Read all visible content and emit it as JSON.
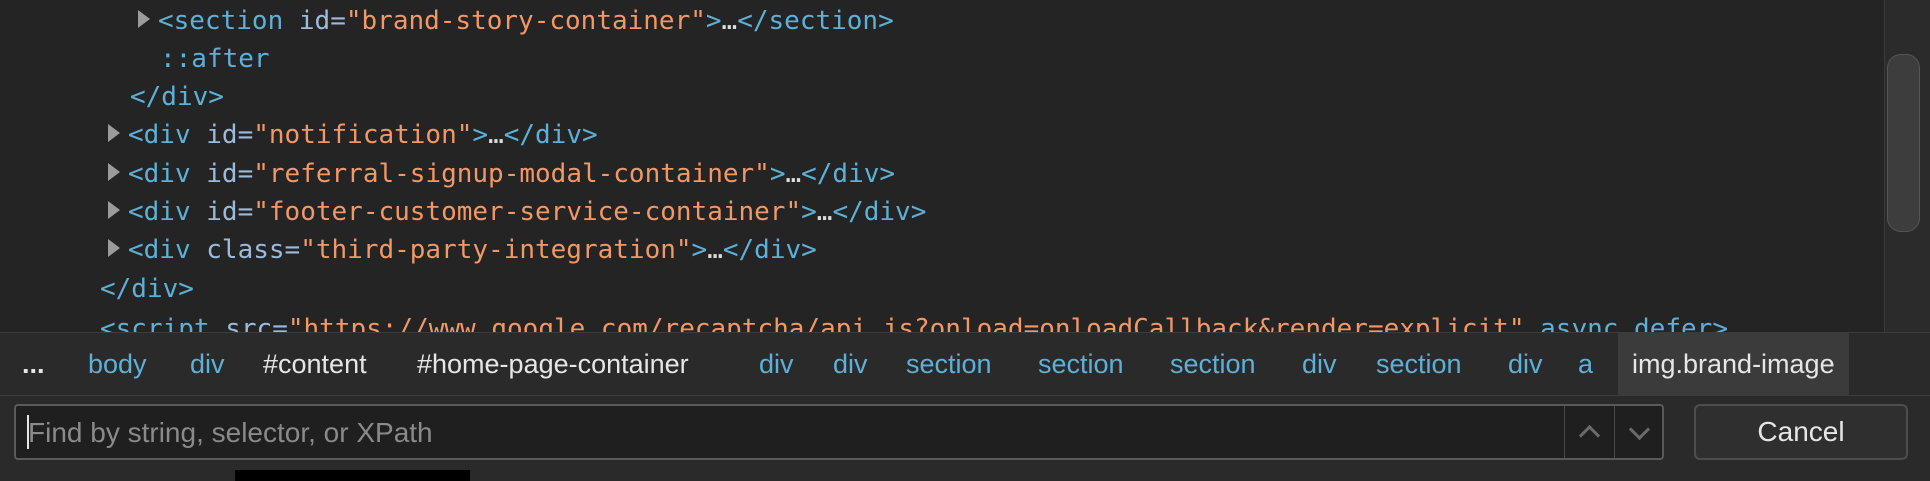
{
  "dom_tree": {
    "lines": [
      {
        "open": "<section",
        "attr": " id=",
        "val": "\"brand-story-container\"",
        "gt": ">",
        "ell": "…",
        "close": "</section>"
      },
      {
        "text": "::after"
      },
      {
        "text": "</div>"
      },
      {
        "open": "<div",
        "attr": " id=",
        "val": "\"notification\"",
        "gt": ">",
        "ell": "…",
        "close": "</div>"
      },
      {
        "open": "<div",
        "attr": " id=",
        "val": "\"referral-signup-modal-container\"",
        "gt": ">",
        "ell": "…",
        "close": "</div>"
      },
      {
        "open": "<div",
        "attr": " id=",
        "val": "\"footer-customer-service-container\"",
        "gt": ">",
        "ell": "…",
        "close": "</div>"
      },
      {
        "open": "<div",
        "attr": " class=",
        "val": "\"third-party-integration\"",
        "gt": ">",
        "ell": "…",
        "close": "</div>"
      },
      {
        "text": "</div>"
      },
      {
        "open": "<script",
        "attr": " src=",
        "val": "\"https://www.google.com/recaptcha/api.js?onload=onloadCallback&render=explicit\"",
        "tail": " async defer>"
      }
    ]
  },
  "breadcrumb": {
    "items": [
      "...",
      "body",
      "div",
      "#content",
      "#home-page-container",
      "div",
      "div",
      "section",
      "section",
      "section",
      "div",
      "section",
      "div",
      "a",
      "img.brand-image"
    ]
  },
  "find_bar": {
    "placeholder": "Find by string, selector, or XPath",
    "value": "",
    "cancel_label": "Cancel"
  },
  "icons": {
    "expand": "disclosure-triangle-icon",
    "prev": "chevron-up-icon",
    "next": "chevron-down-icon"
  },
  "colors": {
    "background": "#242424",
    "tag": "#5db0d7",
    "attribute": "#9bbbdc",
    "value": "#f29766"
  }
}
